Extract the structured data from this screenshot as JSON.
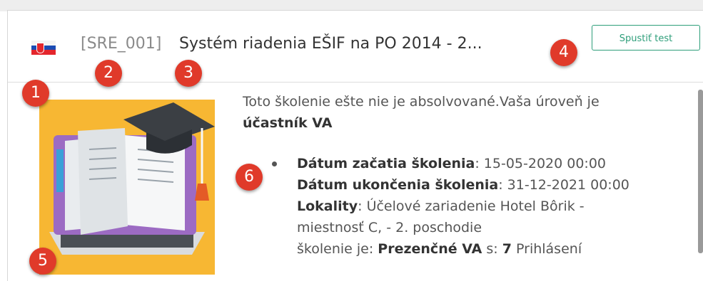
{
  "header": {
    "code": "[SRE_001]",
    "title": "Systém riadenia EŠIF na PO 2014 - 2...",
    "test_button": "Spustiť test"
  },
  "badges": [
    "1",
    "2",
    "3",
    "4",
    "5",
    "6"
  ],
  "status": {
    "line1": "Toto školenie ešte nie je absolvované.Vaša úroveň je",
    "level": "účastník VA"
  },
  "details": {
    "start_label": "Dátum začatia školenia",
    "start_value": ": 15-05-2020 00:00",
    "end_label": "Dátum ukončenia školenia",
    "end_value": ": 31-12-2021 00:00",
    "location_label": "Lokality",
    "location_value": ": Účelové zariadenie Hotel Bôrik -",
    "location_value2": "miestnosť C, - 2. poschodie",
    "type_prefix": "školenie je: ",
    "type_value": "Prezenčné VA",
    "count_prefix": " s: ",
    "count_value": "7",
    "count_suffix": " Prihlásení"
  },
  "colors": {
    "accent": "#2e9e7a",
    "badge": "#e03a2a",
    "thumb_bg": "#f7b733"
  },
  "icons": {
    "flag": "slovakia-flag-icon",
    "thumbnail": "book-laptop-graduation-illustration"
  }
}
